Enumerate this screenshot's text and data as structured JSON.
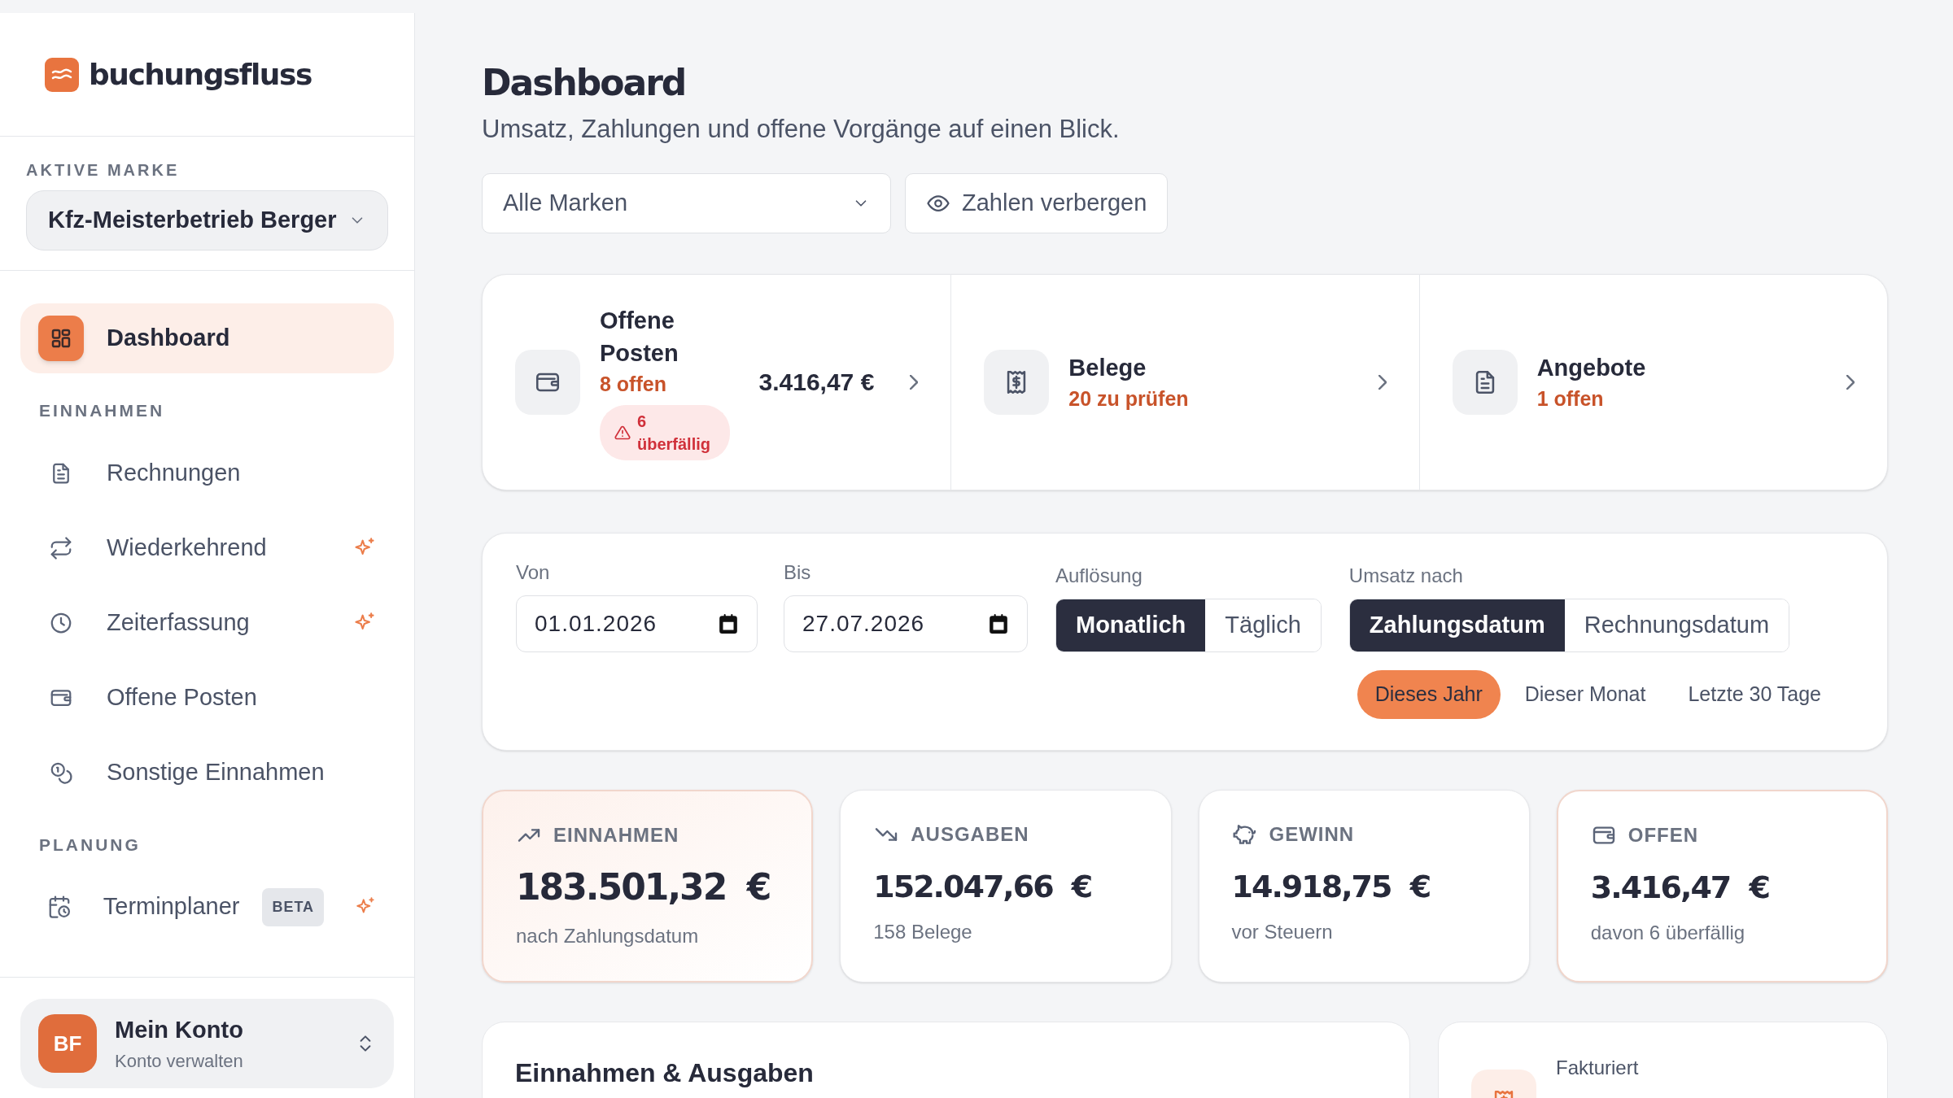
{
  "sidebar": {
    "brand": {
      "name": "buchungsfluss"
    },
    "brand_selector": {
      "label": "AKTIVE MARKE",
      "value": "Kfz-Meisterbetrieb Berger"
    },
    "sections": [
      {
        "items": [
          {
            "label": "Dashboard",
            "selected": true,
            "new": false
          }
        ]
      },
      {
        "heading": "EINNAHMEN",
        "items": [
          {
            "label": "Rechnungen",
            "selected": false,
            "new": false
          },
          {
            "label": "Wiederkehrend",
            "selected": false,
            "new": true
          },
          {
            "label": "Zeiterfassung",
            "selected": false,
            "new": true
          },
          {
            "label": "Offene Posten",
            "selected": false,
            "new": false
          },
          {
            "label": "Sonstige Einnahmen",
            "selected": false,
            "new": false
          }
        ]
      },
      {
        "heading": "PLANUNG",
        "items": [
          {
            "label": "Terminplaner",
            "selected": false,
            "new": true,
            "badge": "BETA"
          }
        ]
      }
    ],
    "account": {
      "initials": "BF",
      "name": "Mein Konto",
      "subtitle": "Konto verwalten"
    }
  },
  "header": {
    "title": "Dashboard",
    "subtitle": "Umsatz, Zahlungen und offene Vorgänge auf einen Blick.",
    "brand_filter": {
      "value": "Alle Marken"
    },
    "hide_button": {
      "label": "Zahlen verbergen"
    }
  },
  "summary_tiles": [
    {
      "title": "Offene Posten",
      "status": "8 offen",
      "amount": "3.416,47 €",
      "alert": "6 überfällig"
    },
    {
      "title": "Belege",
      "status": "20 zu prüfen"
    },
    {
      "title": "Angebote",
      "status": "1 offen"
    }
  ],
  "filters": {
    "from": {
      "label": "Von",
      "value": "01.01.2026"
    },
    "to": {
      "label": "Bis",
      "value": "27.07.2026"
    },
    "toggles": [
      {
        "label": "Auflösung",
        "options": [
          {
            "label": "Monatlich",
            "selected": true
          },
          {
            "label": "Täglich",
            "selected": false
          }
        ]
      },
      {
        "label": "Umsatz nach",
        "options": [
          {
            "label": "Zahlungsdatum",
            "selected": true
          },
          {
            "label": "Rechnungsdatum",
            "selected": false
          }
        ]
      }
    ],
    "presets": [
      {
        "label": "Dieses Jahr",
        "selected": true
      },
      {
        "label": "Dieser Monat",
        "selected": false
      },
      {
        "label": "Letzte 30 Tage",
        "selected": false
      }
    ]
  },
  "kpis": [
    {
      "label": "EINNAHMEN",
      "value": "183.501,32 €",
      "note": "nach Zahlungsdatum"
    },
    {
      "label": "AUSGABEN",
      "value": "152.047,66 €",
      "note": "158 Belege"
    },
    {
      "label": "GEWINN",
      "value": "14.918,75 €",
      "note": "vor Steuern"
    },
    {
      "label": "OFFEN",
      "value": "3.416,47 €",
      "note": "davon 6 überfällig"
    }
  ],
  "panels": {
    "chart": {
      "title": "Einnahmen & Ausgaben"
    },
    "invoiced": {
      "label": "Fakturiert"
    }
  }
}
